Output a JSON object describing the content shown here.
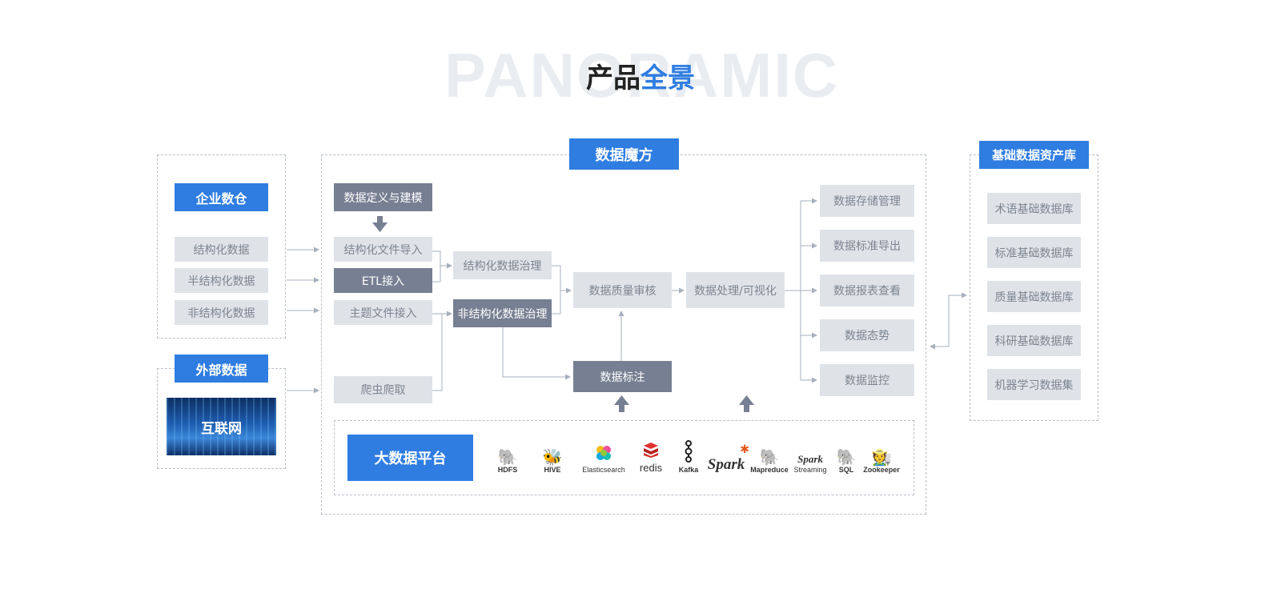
{
  "header": {
    "bg_word": "PANORAMIC",
    "title_dark": "产品",
    "title_accent": "全景"
  },
  "sources": {
    "enterprise_label": "企业数仓",
    "items": [
      "结构化数据",
      "半结构化数据",
      "非结构化数据"
    ],
    "external_label": "外部数据",
    "internet_label": "互联网"
  },
  "cube": {
    "title": "数据魔方",
    "define": "数据定义与建模",
    "ingest": [
      "结构化文件导入",
      "ETL接入",
      "主题文件接入",
      "爬虫爬取"
    ],
    "govern": [
      "结构化数据治理",
      "非结构化数据治理"
    ],
    "quality": "数据质量审核",
    "annotate": "数据标注",
    "process": "数据处理/可视化",
    "outputs": [
      "数据存储管理",
      "数据标准导出",
      "数据报表查看",
      "数据态势",
      "数据监控"
    ],
    "platform_label": "大数据平台",
    "logos": [
      {
        "name": "HDFS",
        "icon": "elephant-icon"
      },
      {
        "name": "HIVE",
        "icon": "bee-elephant-icon"
      },
      {
        "name": "Elasticsearch",
        "icon": "elastic-icon"
      },
      {
        "name": "redis",
        "icon": "redis-cube-icon"
      },
      {
        "name": "Kafka",
        "icon": "kafka-icon"
      },
      {
        "name": "Spark",
        "icon": "spark-star-icon"
      },
      {
        "name": "Mapreduce",
        "icon": "elephant-icon"
      },
      {
        "name": "Streaming",
        "icon": "spark-streaming-icon"
      },
      {
        "name": "SQL",
        "icon": "elephant-icon"
      },
      {
        "name": "Zookeeper",
        "icon": "zookeeper-icon"
      }
    ],
    "logo_word_spark": "Spark",
    "logo_word_spark_small": "Spark"
  },
  "library": {
    "title": "基础数据资产库",
    "items": [
      "术语基础数据库",
      "标准基础数据库",
      "质量基础数据库",
      "科研基础数据库",
      "机器学习数据集"
    ]
  },
  "colors": {
    "accent": "#2f7de1",
    "slate": "#777f92",
    "light": "#dfe3e8",
    "line": "#a7b0bd"
  }
}
